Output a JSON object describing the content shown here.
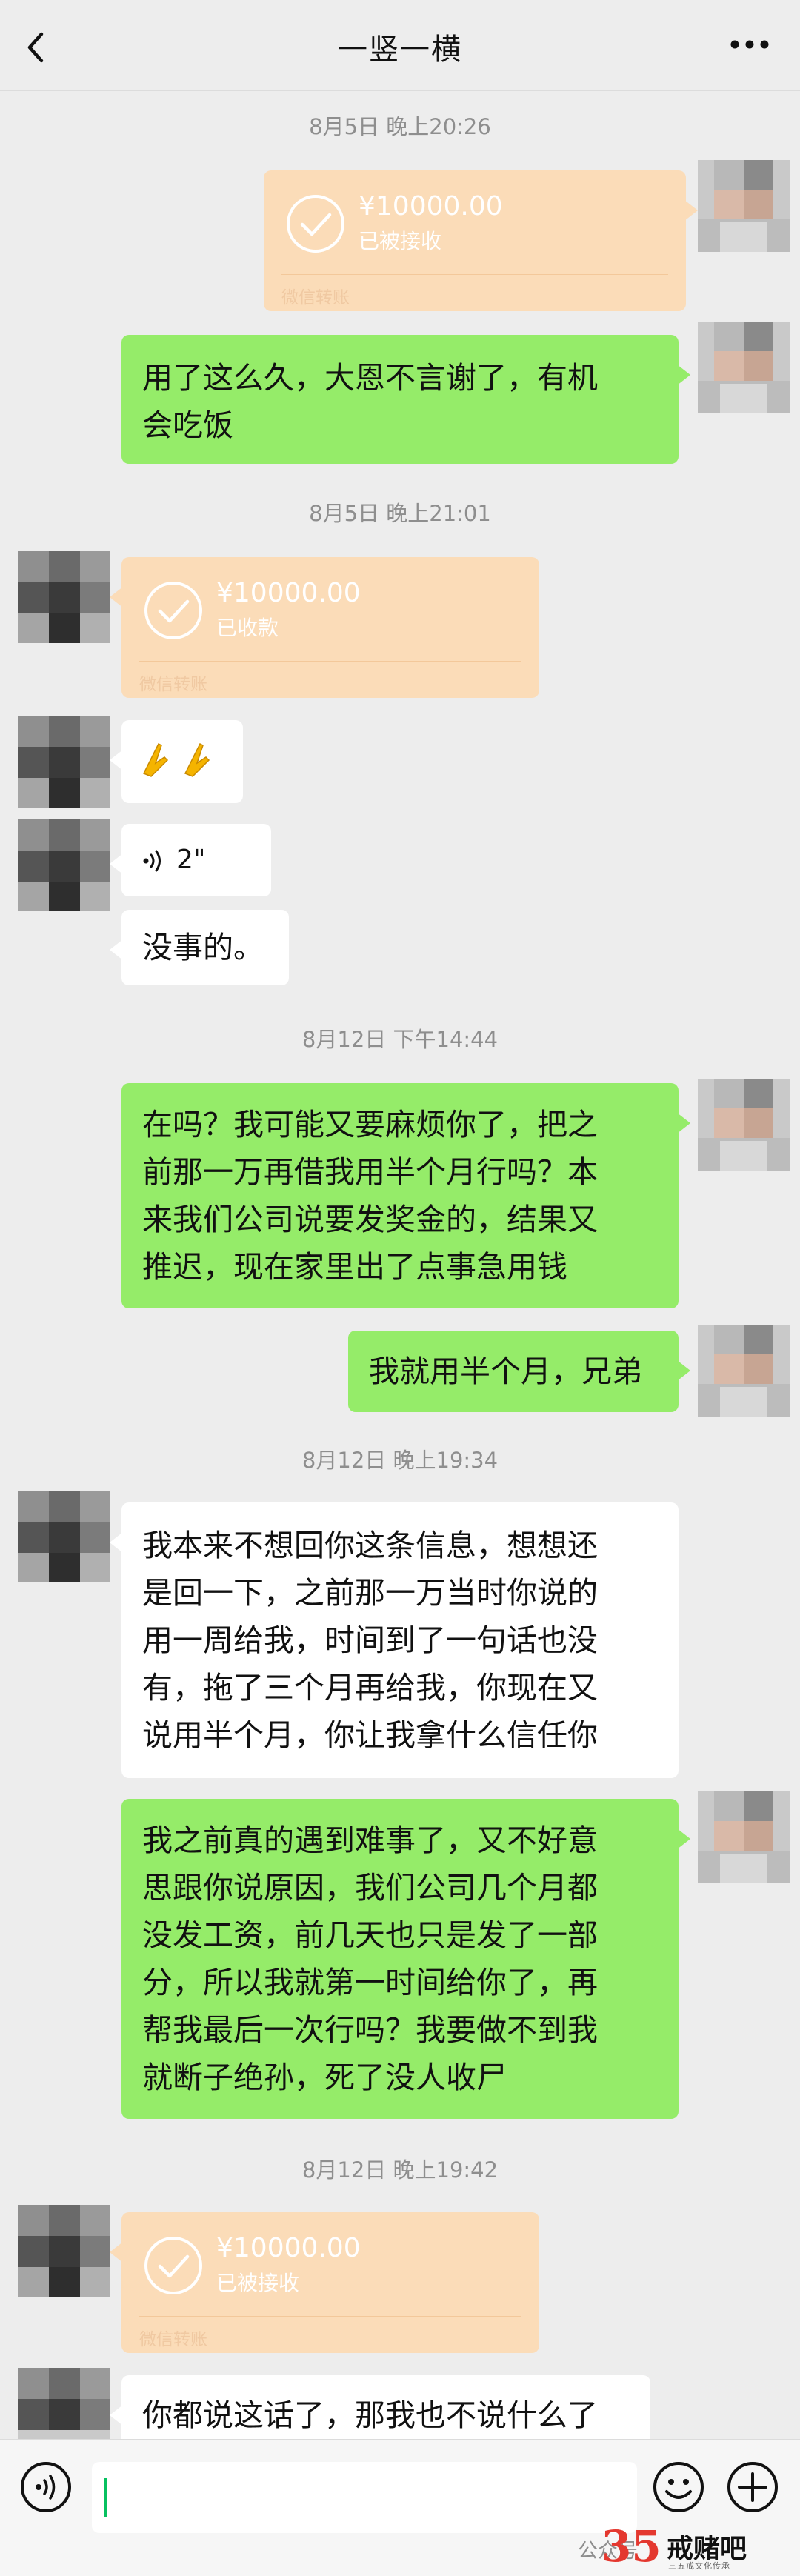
{
  "header": {
    "title": "一竖一横"
  },
  "timestamps": {
    "t1": "8月5日 晚上20:26",
    "t2": "8月5日 晚上21:01",
    "t3": "8月12日 下午14:44",
    "t4": "8月12日 晚上19:34",
    "t5": "8月12日 晚上19:42"
  },
  "messages": {
    "transfer1": {
      "amount": "¥10000.00",
      "status": "已被接收",
      "footer": "微信转账"
    },
    "msg1": {
      "lines": [
        "用了这么久，大恩不言谢了，有机",
        "会吃饭"
      ]
    },
    "transfer2": {
      "amount": "¥10000.00",
      "status": "已收款",
      "footer": "微信转账"
    },
    "emoji": {
      "text": "🙏🙏"
    },
    "voice": {
      "duration": "2\""
    },
    "msg2": {
      "text": "没事的。"
    },
    "msg3": {
      "lines": [
        "在吗？我可能又要麻烦你了，把之",
        "前那一万再借我用半个月行吗？本",
        "来我们公司说要发奖金的，结果又",
        "推迟，现在家里出了点事急用钱"
      ]
    },
    "msg4": {
      "text": "我就用半个月，兄弟"
    },
    "msg5": {
      "lines": [
        "我本来不想回你这条信息，想想还",
        "是回一下，之前那一万当时你说的",
        "用一周给我，时间到了一句话也没",
        "有，拖了三个月再给我，你现在又",
        "说用半个月，你让我拿什么信任你"
      ]
    },
    "msg6": {
      "lines": [
        "我之前真的遇到难事了，又不好意",
        "思跟你说原因，我们公司几个月都",
        "没发工资，前几天也只是发了一部",
        "分，所以我就第一时间给你了，再",
        "帮我最后一次行吗？我要做不到我",
        "就断子绝孙，死了没人收尸"
      ]
    },
    "transfer3": {
      "amount": "¥10000.00",
      "status": "已被接收",
      "footer": "微信转账"
    },
    "msg7": {
      "text": "你都说这话了，那我也不说什么了"
    }
  },
  "bottom": {
    "watermark": "公众号",
    "logo_number": "35",
    "logo_text": "戒赌吧",
    "logo_sub": "三五戒文化传承"
  },
  "icons": [
    "back-icon",
    "more-icon",
    "check-circle-icon",
    "voice-icon",
    "voice-input-icon",
    "emoji-icon",
    "plus-icon"
  ],
  "colors": {
    "me_bubble": "#95ec69",
    "other_bubble": "#ffffff",
    "transfer": "#fbdcb8",
    "background": "#ededed",
    "logo_red": "#e4382f"
  }
}
